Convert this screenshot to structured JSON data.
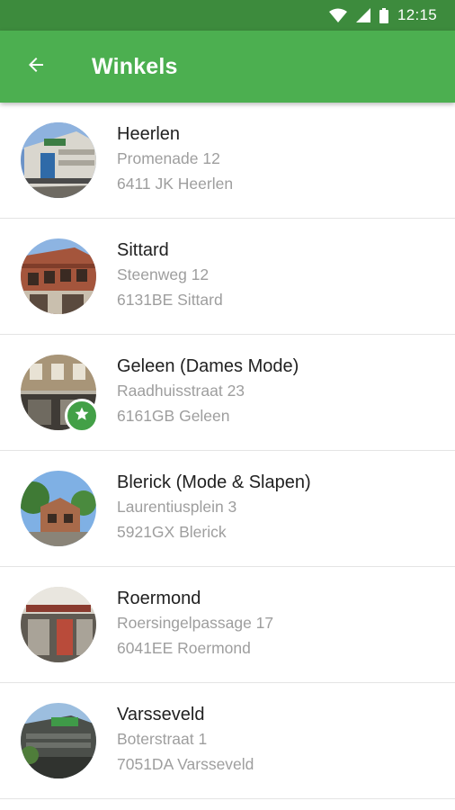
{
  "status_bar": {
    "time": "12:15",
    "icons": [
      "wifi-icon",
      "cell-signal-icon",
      "battery-icon"
    ]
  },
  "app_bar": {
    "back_icon": "arrow-back-icon",
    "title": "Winkels"
  },
  "colors": {
    "status_bar": "#3d8b3d",
    "app_bar": "#4caf50",
    "favorite_badge": "#43a047",
    "primary_text": "#212121",
    "secondary_text": "#9e9e9e",
    "divider": "#e4e4e4"
  },
  "stores": [
    {
      "name": "Heerlen",
      "street": "Promenade 12",
      "city": "6411 JK Heerlen",
      "favorite": false
    },
    {
      "name": "Sittard",
      "street": "Steenweg 12",
      "city": "6131BE Sittard",
      "favorite": false
    },
    {
      "name": "Geleen (Dames Mode)",
      "street": "Raadhuisstraat 23",
      "city": "6161GB Geleen",
      "favorite": true
    },
    {
      "name": "Blerick (Mode & Slapen)",
      "street": "Laurentiusplein 3",
      "city": "5921GX Blerick",
      "favorite": false
    },
    {
      "name": "Roermond",
      "street": "Roersingelpassage 17",
      "city": "6041EE Roermond",
      "favorite": false
    },
    {
      "name": "Varsseveld",
      "street": "Boterstraat 1",
      "city": "7051DA Varsseveld",
      "favorite": false
    }
  ]
}
